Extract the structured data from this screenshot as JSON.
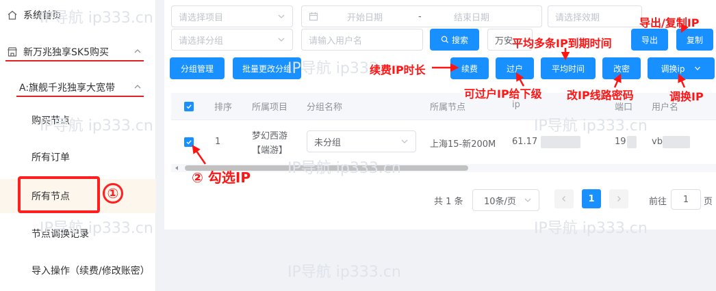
{
  "sidebar": {
    "home": "系统首页",
    "group": "新万兆独享SK5购买",
    "subgroup": "A:旗舰千兆独享大宽带",
    "items": [
      "购买节点",
      "所有订单",
      "所有节点",
      "节点调换记录",
      "导入操作（续费/修改账密）"
    ]
  },
  "filters": {
    "project_placeholder": "请选择项目",
    "start_date": "开始日期",
    "date_sep": "-",
    "end_date": "结束日期",
    "validity_placeholder": "请选择效期",
    "group_placeholder": "请选择分组",
    "user_placeholder": "请输入用户名",
    "search_label": "搜索",
    "extra_select": "万安"
  },
  "buttons": {
    "export": "导出",
    "copy": "复制",
    "group_manage": "分组管理",
    "batch_change_group": "批量更改分组",
    "renew": "续费",
    "transfer": "过户",
    "avg_time": "平均时间",
    "change_password": "改密",
    "swap_ip": "调换ip"
  },
  "annotations": {
    "export_copy": "导出/复制IP",
    "avg_time": "平均多条IP到期时间",
    "renew": "续费IP时长",
    "transfer": "可过户IP给下级",
    "change_password": "改IP线路密码",
    "swap": "调换IP",
    "check": "② 勾选IP",
    "circle_one": "①"
  },
  "table": {
    "headers": [
      "排序",
      "所属项目",
      "分组名称",
      "所属节点",
      "ip",
      "端口",
      "用户名"
    ],
    "row": {
      "index": "1",
      "project_line1": "梦幻西游",
      "project_line2": "【端游】",
      "group": "未分组",
      "node": "上海15-新200M",
      "ip": "61.17",
      "port": "19",
      "user": "vb"
    }
  },
  "pagination": {
    "total": "共 1 条",
    "page_size": "10条/页",
    "current": "1",
    "goto_label": "前往",
    "goto_value": "1",
    "page_unit": "页"
  },
  "watermark": "IP导航  ip333.cn",
  "colors": {
    "primary": "#1890ff",
    "annotation": "#ff1414"
  }
}
